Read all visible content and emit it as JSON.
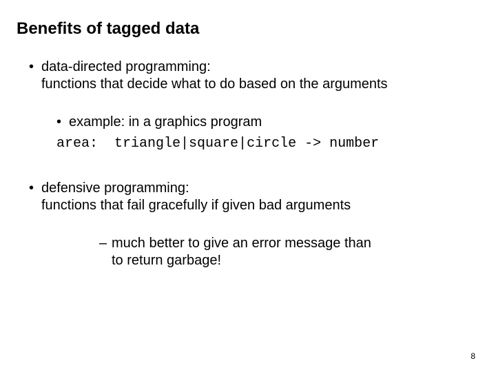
{
  "title": "Benefits of tagged data",
  "bullet1": {
    "term": "data-directed programming:",
    "desc": "functions that decide what to do based on the arguments"
  },
  "example": {
    "intro": "example: in a graphics program",
    "label": "area:",
    "type": "triangle|square|circle -> number"
  },
  "bullet2": {
    "term": "defensive programming:",
    "desc": "functions that fail gracefully if given bad arguments"
  },
  "note": {
    "line1": "much better to give an error message than",
    "line2": "to return garbage!"
  },
  "pageNumber": "8"
}
